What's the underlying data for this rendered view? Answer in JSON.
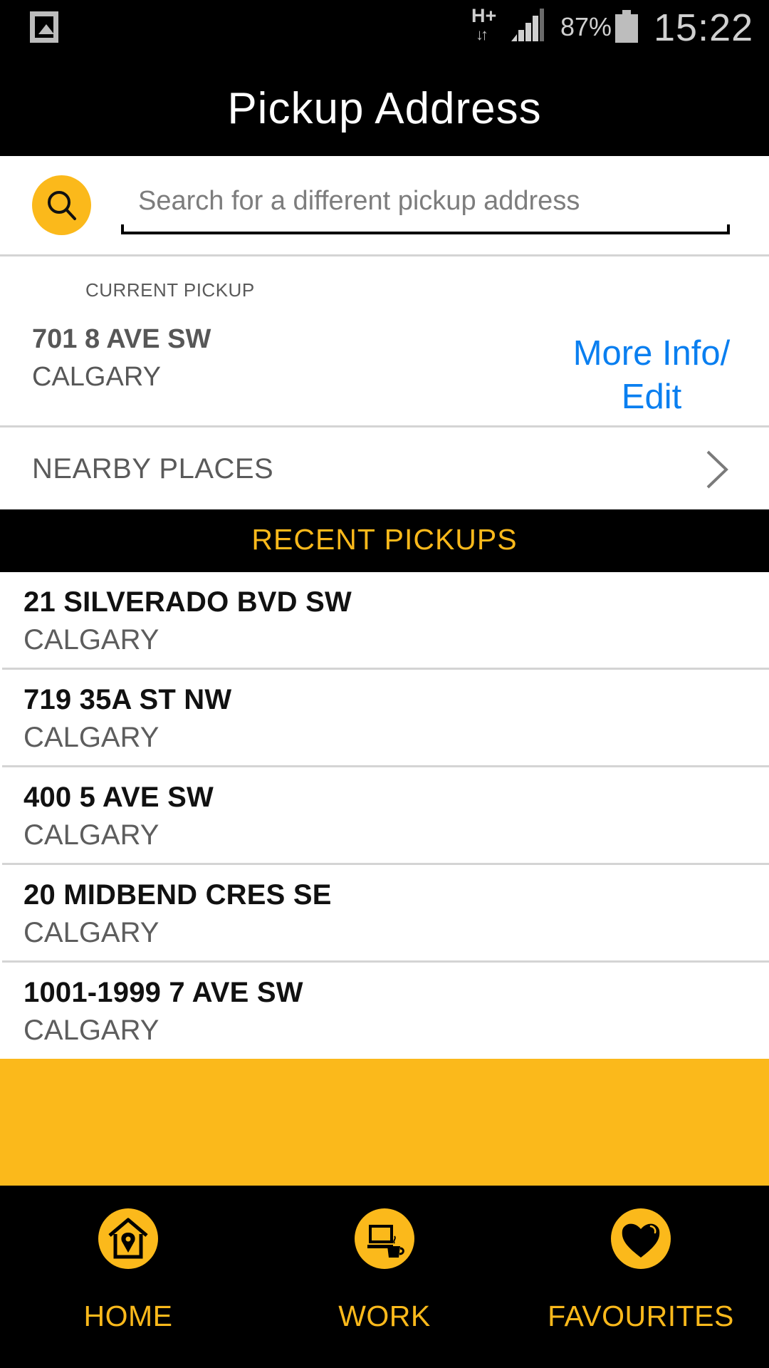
{
  "status_bar": {
    "network": "H+",
    "battery_percent": "87%",
    "time": "15:22"
  },
  "header": {
    "title": "Pickup Address"
  },
  "search": {
    "placeholder": "Search for a different pickup address",
    "value": ""
  },
  "current_pickup": {
    "label": "CURRENT PICKUP",
    "address": "701 8 AVE SW",
    "city": "CALGARY",
    "more_info_line1": "More Info/",
    "more_info_line2": "Edit"
  },
  "nearby": {
    "label": "NEARBY PLACES"
  },
  "recent": {
    "title": "RECENT PICKUPS",
    "items": [
      {
        "street": "21 SILVERADO BVD SW",
        "city": "CALGARY"
      },
      {
        "street": "719 35A ST NW",
        "city": "CALGARY"
      },
      {
        "street": "400 5 AVE SW",
        "city": "CALGARY"
      },
      {
        "street": "20 MIDBEND CRES SE",
        "city": "CALGARY"
      },
      {
        "street": "1001-1999 7 AVE SW",
        "city": "CALGARY"
      }
    ]
  },
  "bottom_nav": {
    "items": [
      {
        "label": "HOME",
        "icon": "home-pin-icon"
      },
      {
        "label": "WORK",
        "icon": "laptop-coffee-icon"
      },
      {
        "label": "FAVOURITES",
        "icon": "heart-icon"
      }
    ]
  },
  "colors": {
    "accent_yellow": "#fbb91b",
    "link_blue": "#0a7ff0",
    "header_bg": "#000000"
  }
}
